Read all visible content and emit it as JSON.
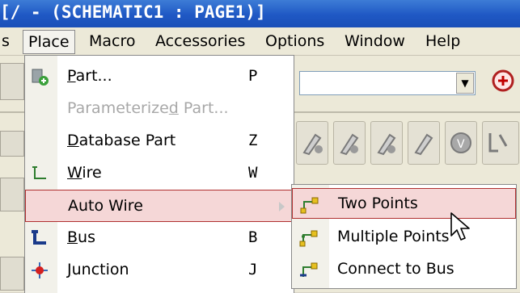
{
  "window": {
    "title": "[/ - (SCHEMATIC1 : PAGE1)]"
  },
  "menubar": {
    "items": [
      {
        "label": "s",
        "active": false
      },
      {
        "label": "Place",
        "active": true
      },
      {
        "label": "Macro",
        "active": false
      },
      {
        "label": "Accessories",
        "active": false
      },
      {
        "label": "Options",
        "active": false
      },
      {
        "label": "Window",
        "active": false
      },
      {
        "label": "Help",
        "active": false
      }
    ]
  },
  "place_menu": {
    "items": [
      {
        "label": "Part...",
        "underline": "P",
        "rest": "art...",
        "shortcut": "P",
        "icon": "part-icon",
        "enabled": true
      },
      {
        "label": "Parameterized Part...",
        "pre": "Parameterize",
        "underline": "d",
        "rest": " Part...",
        "shortcut": "",
        "icon": "",
        "enabled": false
      },
      {
        "label": "Database Part",
        "underline": "D",
        "rest": "atabase Part",
        "shortcut": "Z",
        "icon": "",
        "enabled": true
      },
      {
        "label": "Wire",
        "underline": "W",
        "rest": "ire",
        "shortcut": "W",
        "icon": "wire-icon",
        "enabled": true
      },
      {
        "label": "Auto Wire",
        "underline": "",
        "rest": "Auto Wire",
        "shortcut": "",
        "icon": "",
        "enabled": true,
        "submenu": true
      },
      {
        "label": "Bus",
        "underline": "B",
        "rest": "us",
        "shortcut": "B",
        "icon": "bus-icon",
        "enabled": true
      },
      {
        "label": "Junction",
        "underline": "J",
        "rest": "unction",
        "shortcut": "J",
        "icon": "junction-icon",
        "enabled": true
      }
    ]
  },
  "auto_wire_submenu": {
    "items": [
      {
        "label": "Two Points",
        "icon": "auto-wire-two-points-icon"
      },
      {
        "label": "Multiple Points",
        "icon": "auto-wire-multiple-points-icon"
      },
      {
        "label": "Connect to Bus",
        "icon": "auto-wire-connect-bus-icon"
      }
    ]
  },
  "colors": {
    "title_bar": "#1f58c4",
    "highlight_bg": "#f5d7d7",
    "highlight_border": "#b03030",
    "disabled_text": "#a8a8a8"
  }
}
